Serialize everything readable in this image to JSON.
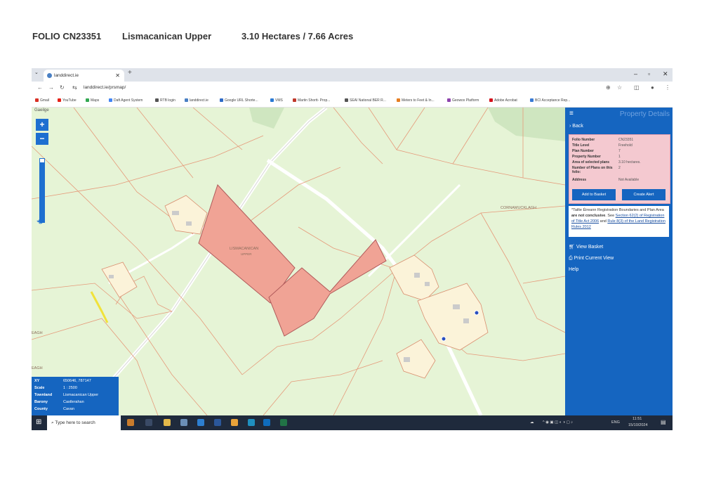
{
  "document_header": {
    "folio": "FOLIO CN23351",
    "townland": "Lismacanican Upper",
    "area": "3.10 Hectares / 7.66 Acres"
  },
  "browser": {
    "tab_title": "landdirect.ie",
    "new_tab_label": "+",
    "url": "landdirect.ie/prsmap/",
    "window_controls": [
      "–",
      "▫",
      "✕"
    ],
    "bookmarks": [
      {
        "label": "Gmail",
        "color": "#d93025"
      },
      {
        "label": "YouTube",
        "color": "#e62117"
      },
      {
        "label": "Maps",
        "color": "#34a853"
      },
      {
        "label": "Daft Agent System",
        "color": "#4285f4"
      },
      {
        "label": "RTB login",
        "color": "#555555"
      },
      {
        "label": "landdirect.ie",
        "color": "#4a80c4"
      },
      {
        "label": "Google URL Shorte...",
        "color": "#2f6bc7"
      },
      {
        "label": "VMS",
        "color": "#2a7ad4"
      },
      {
        "label": "Martin Shortt- Prop...",
        "color": "#c0392b"
      },
      {
        "label": "SEAI National BER R...",
        "color": "#555555"
      },
      {
        "label": "Meters to Feet & In...",
        "color": "#e67e22"
      },
      {
        "label": "Geowox Platform",
        "color": "#8e44ad"
      },
      {
        "label": "Adobe Acrobat",
        "color": "#d4111c"
      },
      {
        "label": "BCI Acceptance Rep...",
        "color": "#3a7bd5"
      }
    ]
  },
  "map": {
    "language_toggle": "Gaeilge",
    "zoom_in": "+",
    "zoom_out": "−",
    "zoom_level": 0.95,
    "labels": {
      "parcel": "LISMACANICAN",
      "parcel_sub": "UPPER",
      "cornamucklagh": "CORNAMUCKLAGH",
      "left_edge_1": "EAGH",
      "left_edge_2": "EAGH"
    },
    "info": {
      "xy_label": "XY",
      "xy_value": "650646, 787147",
      "scale_label": "Scale",
      "scale_value": "1 : 2500",
      "townland_label": "Townland",
      "townland_value": "Lismacanican Upper",
      "barony_label": "Barony",
      "barony_value": "Castlerahan",
      "county_label": "County",
      "county_value": "Cavan"
    }
  },
  "sidebar": {
    "menu_icon": "≡",
    "title": "Property Details",
    "back_label": "Back",
    "details": [
      {
        "key": "Folio Number",
        "value": "CN23351"
      },
      {
        "key": "Title Level",
        "value": "Freehold"
      },
      {
        "key": "Plan Number",
        "value": "7"
      },
      {
        "key": "Property Number",
        "value": "1"
      },
      {
        "key": "Area of selected plans",
        "value": "3.10 hectares."
      },
      {
        "key": "Number of Plans on this folio:",
        "value": "2"
      },
      {
        "key": "Address",
        "value": "Not Available"
      }
    ],
    "add_to_basket": "Add to Basket",
    "create_alert": "Create Alert",
    "note_prefix": "*Tailte Éireann Registration Boundaries and Plan Area ",
    "note_bold": "are not conclusive",
    "note_mid": ". See ",
    "note_link1": "Section 62(2) of Registration of Title Act 2006",
    "note_and": " and ",
    "note_link2": "Rule 8(3) of the Land Registration Rules 2012",
    "view_basket": "View Basket",
    "print_view": "Print Current View",
    "help": "Help"
  },
  "taskbar": {
    "search_placeholder": "Type here to search",
    "language": "ENG",
    "time": "11:51",
    "date": "15/10/2024"
  }
}
